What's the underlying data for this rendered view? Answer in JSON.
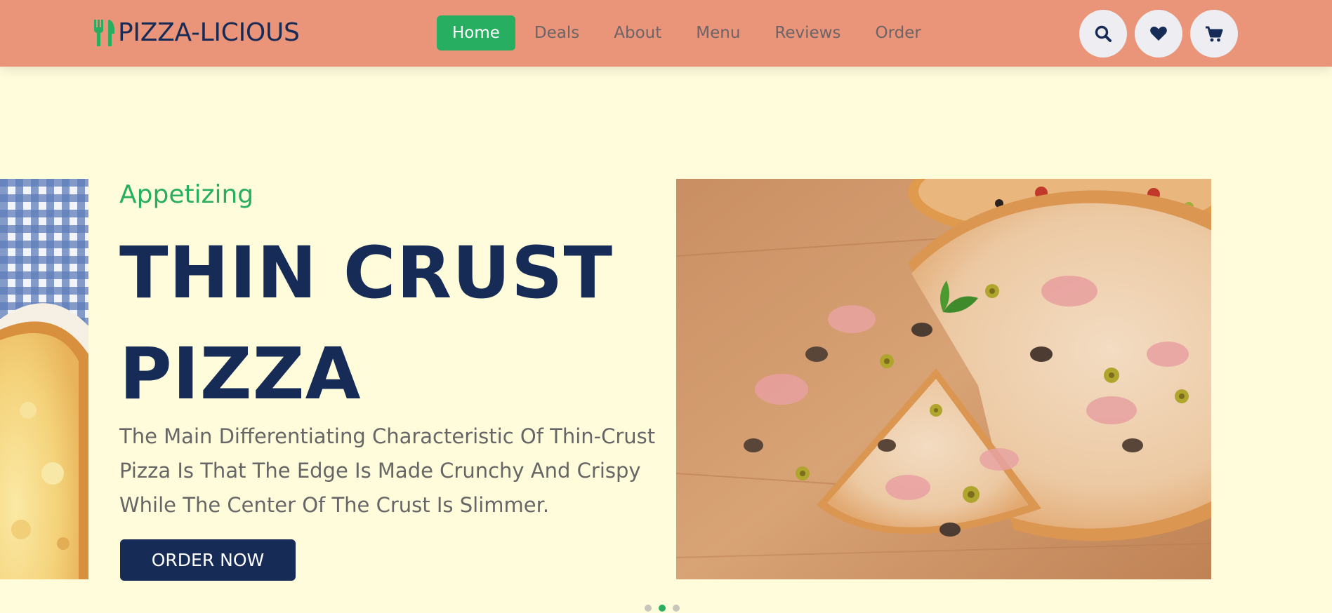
{
  "brand": {
    "name": "PIZZA-LICIOUS",
    "icon": "fork-knife-icon",
    "accent": "#27ae60",
    "navy": "#172b57",
    "header_bg": "#ea957a",
    "page_bg": "#fffcdc"
  },
  "nav": {
    "items": [
      {
        "label": "Home",
        "active": true
      },
      {
        "label": "Deals",
        "active": false
      },
      {
        "label": "About",
        "active": false
      },
      {
        "label": "Menu",
        "active": false
      },
      {
        "label": "Reviews",
        "active": false
      },
      {
        "label": "Order",
        "active": false
      }
    ]
  },
  "header_icons": [
    "search-icon",
    "heart-icon",
    "cart-icon"
  ],
  "hero": {
    "tagline": "Appetizing",
    "headline": "THIN CRUST PIZZA",
    "description": "The Main Differentiating Characteristic Of Thin-Crust Pizza Is That The Edge Is Made Crunchy And Crispy While The Center Of The Crust Is Slimmer.",
    "cta": "ORDER NOW",
    "image": "thin-crust-pizza-photo"
  },
  "slider": {
    "count": 3,
    "active_index": 1
  }
}
